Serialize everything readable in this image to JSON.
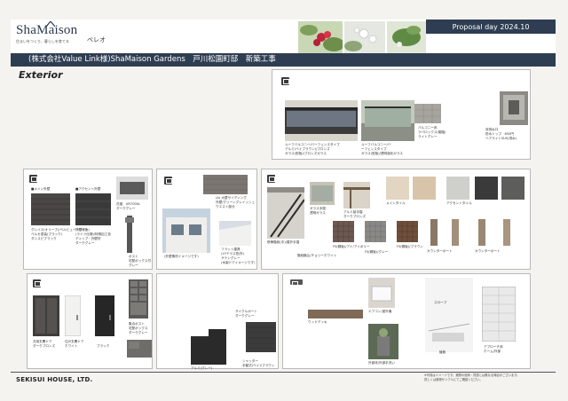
{
  "header": {
    "logo_text": "ShaMaison",
    "logo_tagline": "住まいをつくり、暮らしを育てる",
    "brand_sub": "ベレオ",
    "proposal": "Proposal day 2024.10",
    "project_line": "(株式会社Value Link様)ShaMaison Gardens　戸川松園町邸　新築工事"
  },
  "section_title": "Exterior",
  "panels": {
    "balcony": {
      "items": [
        "ルーフバルコニー/バーフェンスタイプ",
        "アルミ(ベイブラウン)/ブロンズ",
        "ガラス(型板)/ブロンズガラス",
        "ルーフバルコニー/バ",
        "ーフェンスタイプ",
        "ガラス(型板)/透明強化ガラス",
        "バルコニー床",
        "ラバロックス(樹脂)",
        "ライトグレー",
        "床排水口",
        "防水トップ　650円",
        "ヘアライトSUS(排水)"
      ]
    },
    "wall": {
      "label_a": "■メイン外壁",
      "label_b": "■アクセント外壁",
      "items": [
        "グレイス(オリーブ)/ベルビューホワイト/",
        "ベルセ塗装(ブラック)",
        "ダンスピブラック",
        "外壁材色",
        "(ライツ仕様)/特殊加工色",
        "ディップ・外壁材",
        "ダークグレー",
        "花壇　UR7000L",
        "ダークグレー",
        "ポスト",
        "宅配ボックス付",
        "グレー"
      ]
    },
    "gate": {
      "items": [
        "(A) 大壁サイディング",
        "外壁/グリーングレイッシュ",
        "ウエスト部分",
        "(外壁素材イメージです)",
        "フラット建具",
        "(1Fテラス窓/外)",
        "サテングレー",
        "(木製ドアイメージです)"
      ]
    },
    "stairs": {
      "items": [
        "鉄骨階段(中)/屋外手摺",
        "ガラス手摺",
        "透明ガラス",
        "アルミ製手摺",
        "ダークブロンズ",
        "階段蹴込/チョリーホワイト",
        "FS(鋼板)/アイ/アイボリー",
        "FS(鋼板)/グレー",
        "FS(鋼板)/ブラウン",
        "メインタイル",
        "アクセントタイル",
        "カウンターポート",
        "カウンターポート"
      ]
    },
    "entrance": {
      "items": [
        "共用玄関ドア",
        "ダークブロンズ",
        "住戸玄関ドア",
        "ホワイト",
        "ブラック",
        "集合ポスト",
        "宅配ボックス",
        "ダークグレー",
        "アルミ/スレート",
        "シャッター"
      ]
    },
    "bike": {
      "items": [
        "アルミ(グレー)",
        "シャッター",
        "手動式(ベイ)/ブラウン",
        "サイクルポート",
        "ダークグレー"
      ]
    },
    "garden": {
      "items": [
        "ウッドデッキ",
        "エアコン/室外機",
        "外部床/外部手洗い",
        "スロープ",
        "植栽",
        "アプローチ床",
        "ホーム/外部"
      ]
    }
  },
  "footer": {
    "company": "SEKISUI HOUSE, LTD.",
    "disclaimer_1": "※写真はイメージです。実際の色味・質感とは異なる場合がございます。",
    "disclaimer_2": "詳しくは実物サンプルにてご確認ください。"
  }
}
